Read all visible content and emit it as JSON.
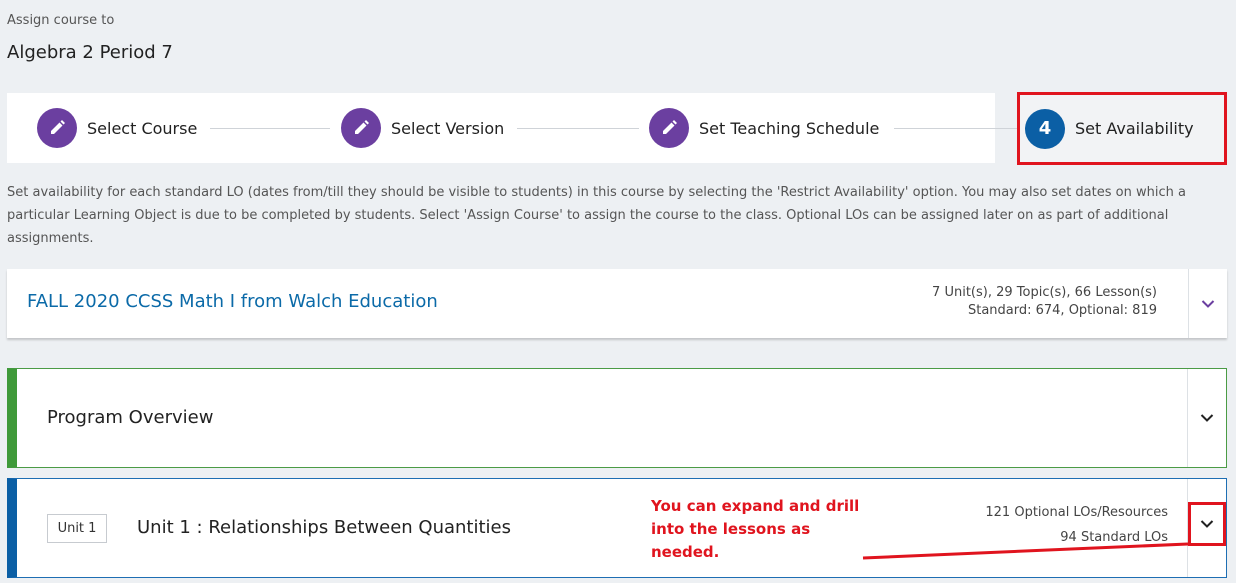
{
  "header": {
    "assign_label": "Assign course to",
    "class_name": "Algebra 2 Period 7"
  },
  "stepper": {
    "steps": [
      {
        "label": "Select Course",
        "icon": "pencil-icon"
      },
      {
        "label": "Select Version",
        "icon": "pencil-icon"
      },
      {
        "label": "Set Teaching Schedule",
        "icon": "pencil-icon"
      },
      {
        "number": "4",
        "label": "Set Availability"
      }
    ]
  },
  "instructions": "Set availability for each standard LO (dates from/till they should be visible to students) in this course by selecting the 'Restrict Availability' option. You may also set dates on which a particular Learning Object is due to be completed by students. Select 'Assign Course' to assign the course to the class. Optional LOs can be assigned later on as part of additional assignments.",
  "course": {
    "title": "FALL 2020 CCSS Math I from Walch Education",
    "stats_line1": "7 Unit(s), 29 Topic(s), 66 Lesson(s)",
    "stats_line2": "Standard: 674, Optional: 819"
  },
  "overview": {
    "title": "Program Overview"
  },
  "unit": {
    "badge": "Unit 1",
    "title": "Unit 1 : Relationships Between Quantities",
    "optional_count": "121 Optional LOs/Resources",
    "standard_count": "94 Standard LOs"
  },
  "annotation": {
    "text": "You can expand and drill into the lessons as needed."
  },
  "colors": {
    "step_done": "#6b3fa0",
    "step_active": "#0b5fa5",
    "course_link": "#0b6aa8",
    "overview_accent": "#3f9a3a",
    "unit_accent": "#0b5fa5",
    "highlight": "#e0141e"
  }
}
